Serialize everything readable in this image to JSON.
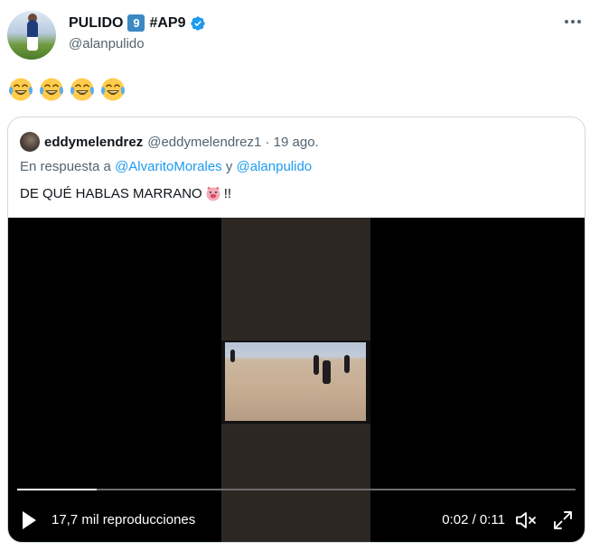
{
  "author": {
    "name": "PULIDO",
    "keycap": "9",
    "tag": "#AP9",
    "handle": "@alanpulido"
  },
  "icons": {
    "more": "more-options-icon",
    "verified": "verified-badge-icon",
    "emoji": "face-with-tears-of-joy",
    "pig": "pig-face",
    "play": "play-icon",
    "mute": "muted-speaker-icon",
    "expand": "fullscreen-icon"
  },
  "tweet": {
    "emoji_count": 4
  },
  "quote": {
    "name": "eddymelendrez",
    "meta": "@eddymelendrez1 · 19 ago.",
    "reply_prefix": "En respuesta a",
    "reply_mention_1": "@AlvaritoMorales",
    "reply_joiner": "y",
    "reply_mention_2": "@alanpulido",
    "text_before": "DE QUÉ HABLAS MARRANO",
    "text_after": "!!"
  },
  "video": {
    "views": "17,7 mil reproducciones",
    "time": "0:02 / 0:11",
    "progress": 0.143
  },
  "colors": {
    "accent": "#1d9bf0",
    "muted_text": "#536471",
    "keycap": "#3b88c3"
  }
}
